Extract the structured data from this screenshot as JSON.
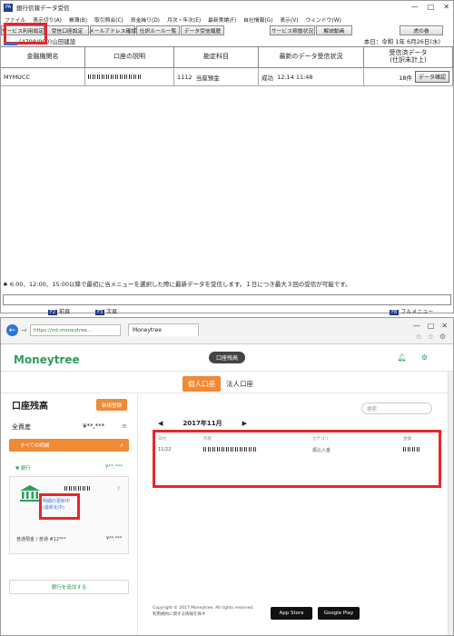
{
  "top_window": {
    "title": "銀行信報データ受信",
    "app_icon": "PA",
    "window_buttons": [
      "—",
      "□",
      "✕"
    ],
    "menu": [
      "ファイル",
      "表示切り(A)",
      "帳簿(B)",
      "取引照会(C)",
      "資金繰り(D)",
      "月次・年次(E)",
      "最新実績(F)",
      "自社情報(G)",
      "表示(V)",
      "ウィンドウ(W)"
    ],
    "toolbar": [
      "サービス利用設定",
      "受信口座設定",
      "メールアドレス確認",
      "仕訳ルール一覧",
      "データ受信履歴",
      "サービス稼働状況",
      "解説動画",
      "虎の巻"
    ],
    "company": "(4798/990)山田建設",
    "date": "本日：令和 1年 6月26日(水)",
    "table": {
      "headers": [
        "金融機関名",
        "口座の説明",
        "勘定科目",
        "最新のデータ受信状況",
        "受信済データ\n(仕訳未計上)"
      ],
      "rows": [
        {
          "bank": "MYMUCC",
          "desc": "",
          "account_code": "1112",
          "account_name": "当座預金",
          "status": "成功",
          "received_at": "12.14 11:48",
          "count": "18件",
          "action": "データ確認"
        }
      ]
    },
    "note": "♠ 6:00、12:00、15:00以降で最初に当メニューを選択した際に最新データを受信します。１日につき最大３回の受信が可能です。",
    "fkeys": [
      {
        "key": "F2",
        "label": "前頁"
      },
      {
        "key": "F3",
        "label": "次頁"
      },
      {
        "key": "F8",
        "label": "フルメニュー"
      }
    ]
  },
  "browser": {
    "url": "https://mt.moneytree...",
    "tab_title": "Moneytree",
    "window_buttons": [
      "—",
      "□",
      "✕"
    ],
    "tool_icons": [
      "☆",
      "☆",
      "⚙"
    ]
  },
  "moneytree": {
    "logo": "Moneytree",
    "page_tag": "口座残高",
    "tabs": {
      "personal": "個人口座",
      "corporate": "法人口座"
    },
    "sidebar": {
      "title": "口座残高",
      "new_button": "新規登録",
      "total_label": "全資産",
      "total_value": "¥**,***",
      "all_transactions": "すべての明細",
      "bank_section": "銀行",
      "bank_total": "¥**,***",
      "card_link": "明細の更新中\n(最新化中)",
      "card_account": "普通預金 / 普通 #12***",
      "card_balance": "¥**,***",
      "add_bank": "銀行を追加する"
    },
    "main": {
      "search_placeholder": "検索",
      "month": "2017年11月",
      "columns": [
        "日付",
        "内容",
        "カテゴリ",
        "金額"
      ],
      "row": {
        "date": "11/22",
        "desc": "———",
        "category": "振込入金",
        "amount": "———"
      }
    },
    "footer": {
      "copyright": "Copyright © 2017 Moneytree. All rights reserved.",
      "link": "利用規約に関する情報を探す",
      "app_store": "App Store",
      "google_play": "Google Play"
    }
  }
}
